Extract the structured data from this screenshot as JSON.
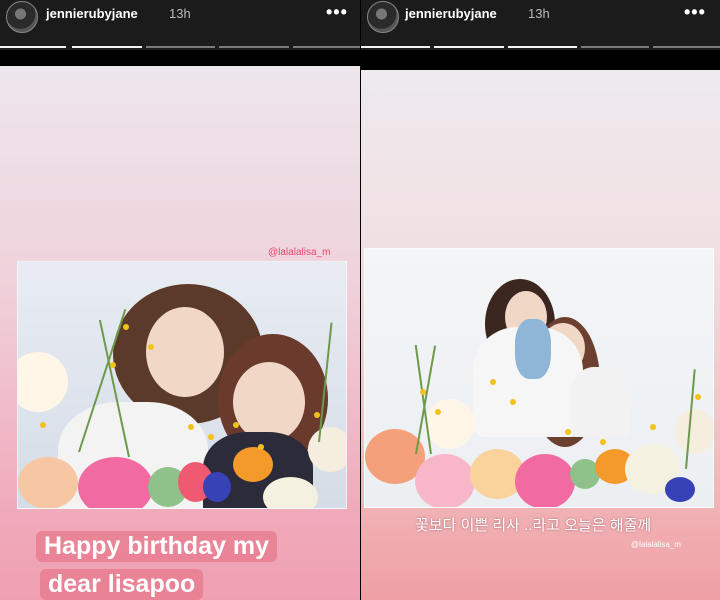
{
  "stories": [
    {
      "username": "jennierubyjane",
      "time": "13h",
      "more": "•••",
      "mention": "@lalalalisa_m",
      "caption_line1": "Happy birthday my",
      "caption_line2": "dear lisapoo",
      "progress_segments": 5,
      "progress_active": 2
    },
    {
      "username": "jennierubyjane",
      "time": "13h",
      "more": "•••",
      "caption": "꽃보다 이쁜 리사 ..라고 오늘은 해줄께",
      "mention": "@lalalalisa_m",
      "progress_segments": 5,
      "progress_active": 3
    }
  ],
  "colors": {
    "header_bg": "#1b1b1b",
    "mention": "#e3496b",
    "caption_box": "#e8788c"
  }
}
